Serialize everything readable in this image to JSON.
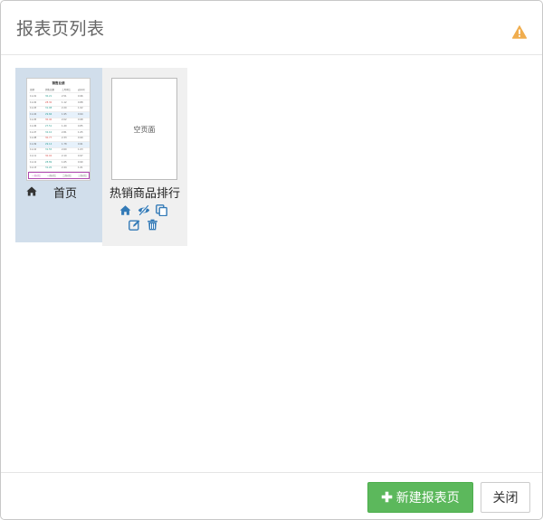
{
  "dialog": {
    "title": "报表页列表"
  },
  "pages": [
    {
      "label": "首页",
      "active": true,
      "thumbnail": {
        "title": "销售业绩",
        "columns": [
          "日期",
          "销售总额",
          "上月环比",
          "去年同"
        ],
        "rows": [
          [
            "11-01",
            "30.21",
            "2.51",
            "0.96"
          ],
          [
            "11-02",
            "28.30",
            "1.12",
            "0.88"
          ],
          [
            "11-03",
            "31.08",
            "2.20",
            "1.02"
          ],
          [
            "11-04",
            "29.66",
            "1.95",
            "0.94"
          ],
          [
            "11-05",
            "30.40",
            "2.02",
            "0.98"
          ],
          [
            "11-06",
            "27.51",
            "1.40",
            "0.85"
          ],
          [
            "11-07",
            "32.10",
            "2.81",
            "1.05"
          ],
          [
            "11-08",
            "30.77",
            "2.33",
            "0.99"
          ],
          [
            "11-09",
            "29.14",
            "1.78",
            "0.91"
          ],
          [
            "11-10",
            "31.55",
            "2.60",
            "1.03"
          ],
          [
            "11-11",
            "30.02",
            "2.10",
            "0.97"
          ],
          [
            "11-12",
            "28.89",
            "1.65",
            "0.90"
          ],
          [
            "11-13",
            "31.20",
            "2.44",
            "1.01"
          ]
        ],
        "tabs": [
          "一日对比",
          "一周对比",
          "二周对比",
          "三周对比"
        ]
      }
    },
    {
      "label": "热销商品排行",
      "active": false,
      "thumbnail_label": "空页面"
    }
  ],
  "footer": {
    "new_label": "新建报表页",
    "close_label": "关闭"
  },
  "colors": {
    "accent": "#337ab7",
    "success": "#5cb85c",
    "warning": "#f0ad4e",
    "active_card": "#d1deeb"
  }
}
